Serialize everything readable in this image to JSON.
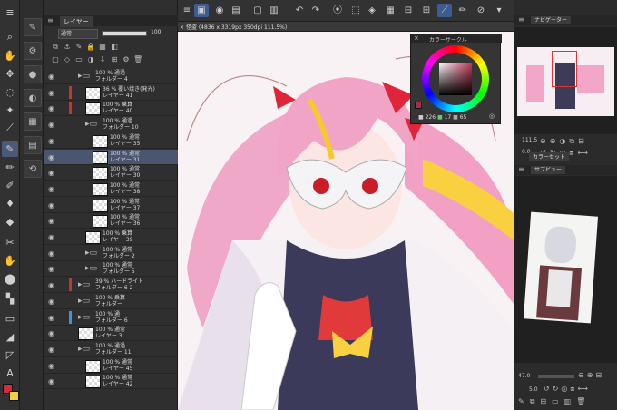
{
  "layer_panel": {
    "tab_label": "レイヤー",
    "blend_mode": "通常",
    "opacity": "100",
    "layers": [
      {
        "opacity_blend": "100 % 通過",
        "name": "フォルダー 4",
        "kind": "folder",
        "indent": 1,
        "marker": ""
      },
      {
        "opacity_blend": "36 % 覆い焼き(発光)",
        "name": "レイヤー 41",
        "kind": "layer",
        "indent": 2,
        "marker": "#c0392b"
      },
      {
        "opacity_blend": "100 % 乗算",
        "name": "レイヤー 40",
        "kind": "layer",
        "indent": 2,
        "marker": "#c0392b"
      },
      {
        "opacity_blend": "100 % 通過",
        "name": "フォルダー 10",
        "kind": "folder",
        "indent": 2,
        "marker": ""
      },
      {
        "opacity_blend": "100 % 通常",
        "name": "レイヤー 35",
        "kind": "layer",
        "indent": 3,
        "marker": ""
      },
      {
        "opacity_blend": "100 % 通常",
        "name": "レイヤー 31",
        "kind": "layer",
        "indent": 3,
        "marker": "",
        "selected": true
      },
      {
        "opacity_blend": "100 % 通常",
        "name": "レイヤー 30",
        "kind": "layer",
        "indent": 3,
        "marker": ""
      },
      {
        "opacity_blend": "100 % 通常",
        "name": "レイヤー 38",
        "kind": "layer",
        "indent": 3,
        "marker": ""
      },
      {
        "opacity_blend": "100 % 通常",
        "name": "レイヤー 37",
        "kind": "layer",
        "indent": 3,
        "marker": ""
      },
      {
        "opacity_blend": "100 % 通常",
        "name": "レイヤー 36",
        "kind": "layer",
        "indent": 3,
        "marker": ""
      },
      {
        "opacity_blend": "100 % 乗算",
        "name": "レイヤー 39",
        "kind": "layer",
        "indent": 2,
        "marker": ""
      },
      {
        "opacity_blend": "100 % 通常",
        "name": "フォルダー 2",
        "kind": "folder",
        "indent": 2,
        "marker": ""
      },
      {
        "opacity_blend": "100 % 通常",
        "name": "フォルダー 5",
        "kind": "folder",
        "indent": 2,
        "marker": ""
      },
      {
        "opacity_blend": "39 % ハードライト",
        "name": "フォルダー 6 2",
        "kind": "folder",
        "indent": 1,
        "marker": "#c0392b"
      },
      {
        "opacity_blend": "100 % 乗算",
        "name": "フォルダー",
        "kind": "folder",
        "indent": 1,
        "marker": ""
      },
      {
        "opacity_blend": "100 % 通",
        "name": "フォルダー 6",
        "kind": "folder",
        "indent": 1,
        "marker": "#3498db"
      },
      {
        "opacity_blend": "100 % 通常",
        "name": "レイヤー 3",
        "kind": "layer",
        "indent": 1,
        "marker": ""
      },
      {
        "opacity_blend": "100 % 通過",
        "name": "フォルダー 11",
        "kind": "folder",
        "indent": 1,
        "marker": ""
      },
      {
        "opacity_blend": "100 % 通常",
        "name": "レイヤー 45",
        "kind": "layer",
        "indent": 2,
        "marker": ""
      },
      {
        "opacity_blend": "100 % 通常",
        "name": "レイヤー 42",
        "kind": "layer",
        "indent": 2,
        "marker": ""
      }
    ]
  },
  "document_tab": "× 怪盗 (4836 x 3319px 350dpi 111.5%)",
  "color_window": {
    "title": "カラーサークル",
    "h": "226",
    "s": "17",
    "v": "65",
    "accent": "#a03048"
  },
  "navigator": {
    "tab_label": "ナビゲーター",
    "zoom": "111.5",
    "angle": "0.0"
  },
  "colorset_tab": "カラーセット",
  "subview": {
    "tab_label": "サブビュー",
    "zoom": "47.0",
    "angle": "5.0"
  },
  "colors": {
    "main": "#d62a3a",
    "sub": "#f0d040"
  }
}
